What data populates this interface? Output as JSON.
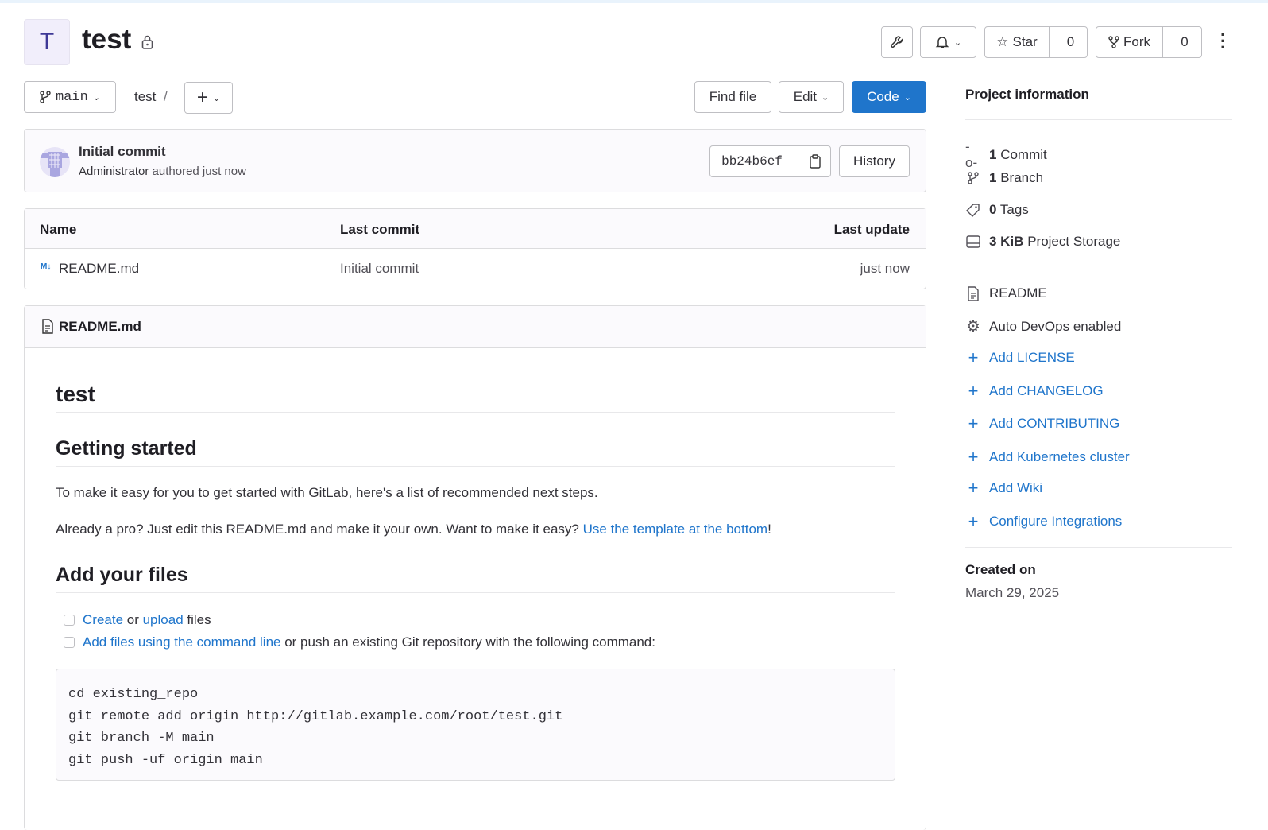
{
  "project": {
    "avatar_letter": "T",
    "name": "test",
    "visibility_icon": "lock-icon"
  },
  "header_actions": {
    "star_label": "Star",
    "star_count": "0",
    "fork_label": "Fork",
    "fork_count": "0"
  },
  "toolbar": {
    "branch": "main",
    "path_root": "test",
    "path_sep": "/",
    "find_file": "Find file",
    "edit": "Edit",
    "code": "Code"
  },
  "last_commit": {
    "title": "Initial commit",
    "author": "Administrator",
    "meta": "authored just now",
    "sha": "bb24b6ef",
    "history": "History"
  },
  "file_table": {
    "headers": [
      "Name",
      "Last commit",
      "Last update"
    ],
    "rows": [
      {
        "name": "README.md",
        "commit": "Initial commit",
        "updated": "just now"
      }
    ]
  },
  "readme": {
    "file_name": "README.md",
    "h1": "test",
    "h2_getting_started": "Getting started",
    "p1": "To make it easy for you to get started with GitLab, here's a list of recommended next steps.",
    "p2_text": "Already a pro? Just edit this README.md and make it your own. Want to make it easy? ",
    "p2_link": "Use the template at the bottom",
    "p2_end": "!",
    "h2_add_files": "Add your files",
    "task1": {
      "link1": "Create",
      "mid": " or ",
      "link2": "upload",
      "end": " files"
    },
    "task2": {
      "link": "Add files using the command line",
      "end": " or push an existing Git repository with the following command:"
    },
    "code_lines": [
      "cd existing_repo",
      "git remote add origin http://gitlab.example.com/root/test.git",
      "git branch -M main",
      "git push -uf origin main"
    ]
  },
  "sidebar": {
    "title": "Project information",
    "stats": [
      {
        "count": "1",
        "label": "Commit"
      },
      {
        "count": "1",
        "label": "Branch"
      },
      {
        "count": "0",
        "label": "Tags"
      },
      {
        "count": "3 KiB",
        "label": "Project Storage"
      }
    ],
    "readme": "README",
    "auto_devops": "Auto DevOps enabled",
    "add_links": [
      "Add LICENSE",
      "Add CHANGELOG",
      "Add CONTRIBUTING",
      "Add Kubernetes cluster",
      "Add Wiki",
      "Configure Integrations"
    ],
    "created_label": "Created on",
    "created_date": "March 29, 2025"
  },
  "colors": {
    "accent": "#1f75cb",
    "text": "#333238",
    "border": "#dcdcde"
  }
}
